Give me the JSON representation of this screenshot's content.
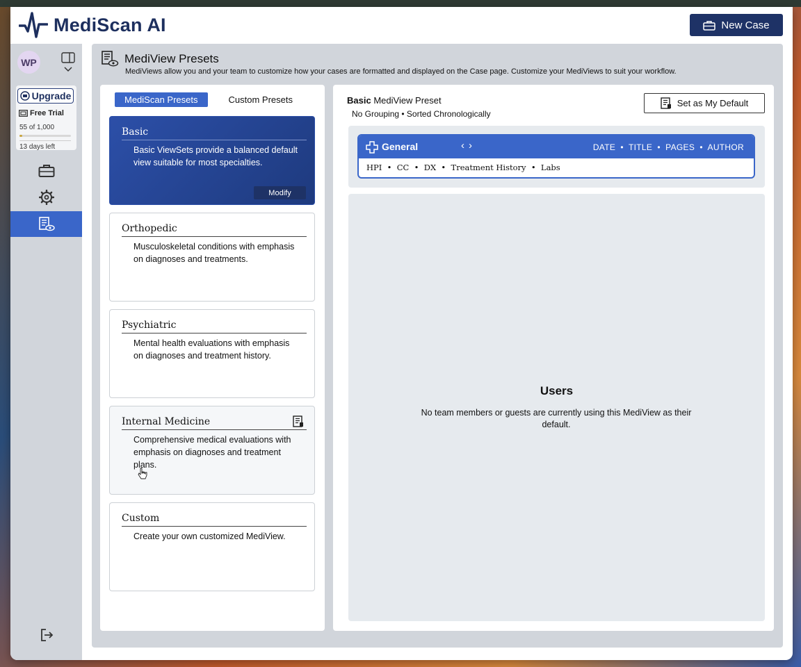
{
  "app": {
    "title": "MediScan AI",
    "new_case_label": "New Case"
  },
  "sidebar": {
    "avatar_initials": "WP",
    "upgrade_label": "Upgrade",
    "trial_label": "Free Trial",
    "trial_usage": "55 of 1,000",
    "trial_usage_fraction": 0.055,
    "trial_days": "13 days left",
    "nav": [
      {
        "icon": "briefcase-icon",
        "active": false
      },
      {
        "icon": "gear-icon",
        "active": false
      },
      {
        "icon": "mediview-icon",
        "active": true
      }
    ],
    "logout_icon": "logout-icon"
  },
  "page": {
    "title": "MediView Presets",
    "subtitle": "MediViews allow you and your team to customize how your cases are formatted and displayed on the Case page. Customize your MediViews to suit your workflow."
  },
  "tabs": {
    "presets_label": "MediScan Presets",
    "custom_label": "Custom Presets"
  },
  "presets": [
    {
      "title": "Basic",
      "description": "Basic ViewSets provide a balanced default view suitable for most specialties.",
      "action": "Modify"
    },
    {
      "title": "Orthopedic",
      "description": "Musculoskeletal conditions with emphasis on diagnoses and treatments."
    },
    {
      "title": "Psychiatric",
      "description": "Mental health evaluations with emphasis on diagnoses and treatment history."
    },
    {
      "title": "Internal Medicine",
      "description": "Comprehensive medical evaluations with emphasis on diagnoses and treatment plans."
    },
    {
      "title": "Custom",
      "description": "Create your own customized MediView."
    }
  ],
  "detail": {
    "preset_name_bold": "Basic",
    "preset_name_rest": "MediView Preset",
    "meta": "No Grouping • Sorted Chronologically",
    "default_button": "Set as My Default",
    "mediview": {
      "title": "General",
      "columns": "DATE  •  TITLE  •  PAGES  •  AUTHOR",
      "sections": "HPI  •  CC  •  DX  •  Treatment History  •  Labs"
    },
    "users_title": "Users",
    "users_message": "No team members or guests are currently using this MediView as their default."
  },
  "colors": {
    "brand": "#1e3266",
    "accent": "#3a66c9",
    "panel": "#d1d5db"
  }
}
